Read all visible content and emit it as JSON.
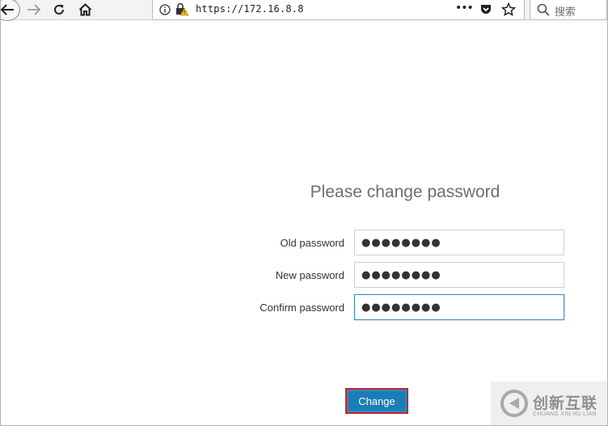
{
  "browser": {
    "url": "https://172.16.8.8",
    "search_placeholder": "搜索",
    "more_icon": "•••"
  },
  "form": {
    "title": "Please change password",
    "fields": [
      {
        "label": "Old password",
        "value": "●●●●●●●●"
      },
      {
        "label": "New password",
        "value": "●●●●●●●●"
      },
      {
        "label": "Confirm password",
        "value": "●●●●●●●●"
      }
    ],
    "submit_label": "Change"
  },
  "watermark": {
    "text": "创新互联",
    "subtext": "CHUANG XIN HU LIAN"
  },
  "colors": {
    "accent": "#1a7eb5",
    "focus_border": "#3a8fb5",
    "highlight_border": "#c8232d"
  }
}
